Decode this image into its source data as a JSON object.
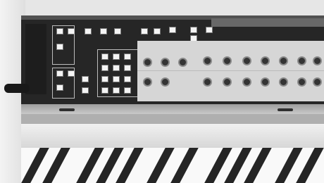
{
  "scene": {
    "subject": "modular-synthesizer-photo",
    "palette": {
      "panel": "#2b2a27",
      "face": "#d6d2c4",
      "keys": "#f4f3ef",
      "blackkeys": "#2a2926"
    }
  }
}
